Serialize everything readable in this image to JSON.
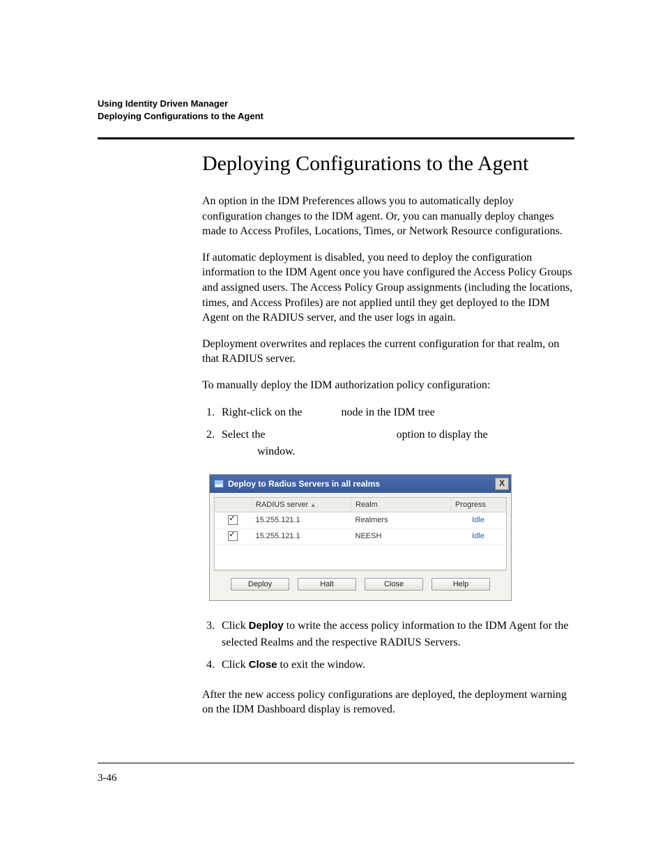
{
  "header": {
    "line1": "Using Identity Driven Manager",
    "line2": "Deploying Configurations to the Agent"
  },
  "title": "Deploying Configurations to the Agent",
  "paragraphs": {
    "p1": "An option in the IDM Preferences allows you to automatically deploy configuration changes to the IDM agent. Or, you can manually deploy changes made to Access Profiles, Locations, Times, or Network Resource configurations.",
    "p2": "If automatic deployment is disabled, you need to deploy the configuration information to the IDM Agent once you have configured the Access Policy Groups and assigned users. The Access Policy Group assignments (including the locations, times, and Access Profiles) are not applied until they get deployed to the IDM Agent on the RADIUS server, and the user logs in again.",
    "p3": "Deployment overwrites and replaces the current configuration for that realm, on that RADIUS server.",
    "p4": "To manually deploy the IDM authorization policy configuration:",
    "p5": "After the new access policy configurations are deployed, the deployment warning on the IDM Dashboard display is removed."
  },
  "steps_a": {
    "s1_a": "Right-click on the ",
    "s1_b": " node in the IDM tree",
    "s2_a": "Select the ",
    "s2_b": " option to display the ",
    "s2_c": " window."
  },
  "steps_b": {
    "s3_a": "Click ",
    "s3_bold": "Deploy",
    "s3_b": " to write the access policy information to the IDM Agent for the selected Realms and the respective RADIUS Servers.",
    "s4_a": "Click ",
    "s4_bold": "Close",
    "s4_b": " to exit the window."
  },
  "dialog": {
    "title": "Deploy to Radius Servers in all realms",
    "columns": {
      "c0": "",
      "c1": "RADIUS server",
      "c2": "Realm",
      "c3": "Progress"
    },
    "rows": [
      {
        "server": "15.255.121.1",
        "realm": "Realmers",
        "progress": "Idle"
      },
      {
        "server": "15.255.121.1",
        "realm": "NEESH",
        "progress": "Idle"
      }
    ],
    "buttons": {
      "deploy": "Deploy",
      "halt": "Halt",
      "close": "Close",
      "help": "Help"
    },
    "close_x": "X"
  },
  "page_number": "3-46"
}
